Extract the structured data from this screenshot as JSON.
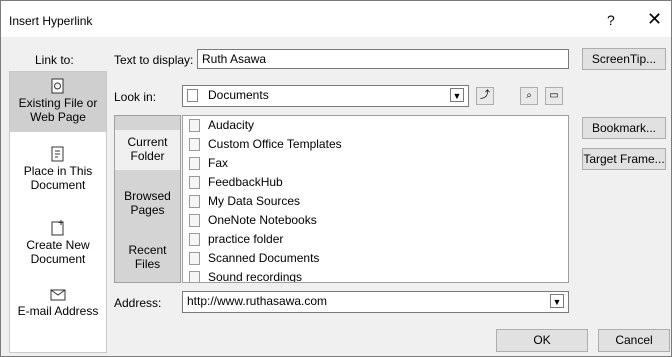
{
  "title": "Insert Hyperlink",
  "titlebar": {
    "help": "?",
    "close": "✕"
  },
  "link_to_label": "Link to:",
  "link_to": [
    {
      "label": "Existing File or Web Page",
      "selected": true
    },
    {
      "label": "Place in This Document",
      "selected": false
    },
    {
      "label": "Create New Document",
      "selected": false
    },
    {
      "label": "E-mail Address",
      "selected": false
    }
  ],
  "text_to_display": {
    "label": "Text to display:",
    "value": "Ruth Asawa"
  },
  "screentip_button": "ScreenTip...",
  "look_in": {
    "label": "Look in:",
    "value": "Documents"
  },
  "bookmark_button": "Bookmark...",
  "target_frame_button": "Target Frame...",
  "browse_tabs": [
    {
      "label": "Current Folder",
      "selected": true
    },
    {
      "label": "Browsed Pages",
      "selected": false
    },
    {
      "label": "Recent Files",
      "selected": false
    }
  ],
  "files": [
    "Audacity",
    "Custom Office Templates",
    "Fax",
    "FeedbackHub",
    "My Data Sources",
    "OneNote Notebooks",
    "practice folder",
    "Scanned Documents",
    "Sound recordings"
  ],
  "address": {
    "label": "Address:",
    "value": "http://www.ruthasawa.com"
  },
  "ok_button": "OK",
  "cancel_button": "Cancel"
}
